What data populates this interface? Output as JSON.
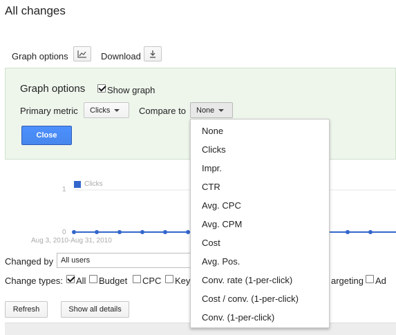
{
  "page": {
    "title": "All changes"
  },
  "toolbar": {
    "graph_options_label": "Graph options",
    "download_label": "Download"
  },
  "panel": {
    "title": "Graph options",
    "show_graph_label": "Show graph",
    "show_graph_checked": true,
    "primary_metric_label": "Primary metric",
    "primary_metric_value": "Clicks",
    "compare_to_label": "Compare to",
    "compare_to_value": "None",
    "close_label": "Close"
  },
  "chart": {
    "legend_label": "Clicks",
    "y_tick_top": "1",
    "y_tick_bottom": "0",
    "date_range": "Aug 3, 2010-Aug 31, 2010",
    "series_color": "#3366cc"
  },
  "chart_data": {
    "type": "line",
    "series": [
      {
        "name": "Clicks",
        "values": [
          0,
          0,
          0,
          0,
          0,
          0,
          0,
          0,
          0,
          0,
          0,
          0,
          0,
          0
        ]
      }
    ],
    "ylim": [
      0,
      1
    ],
    "title": "",
    "xlabel": "Aug 3, 2010-Aug 31, 2010",
    "ylabel": ""
  },
  "dropdown_menu": {
    "items": [
      "None",
      "Clicks",
      "Impr.",
      "CTR",
      "Avg. CPC",
      "Avg. CPM",
      "Cost",
      "Avg. Pos.",
      "Conv. rate (1-per-click)",
      "Cost / conv. (1-per-click)",
      "Conv. (1-per-click)"
    ]
  },
  "filters": {
    "changed_by_label": "Changed by",
    "changed_by_value": "All users",
    "change_types_label": "Change types:",
    "types": [
      {
        "label": "All",
        "checked": true
      },
      {
        "label": "Budget",
        "checked": false
      },
      {
        "label": "CPC",
        "checked": false
      },
      {
        "label": "Key",
        "checked": false
      },
      {
        "label": "argeting",
        "checked": false
      },
      {
        "label": "Ad",
        "checked": false
      }
    ]
  },
  "buttons": {
    "refresh": "Refresh",
    "show_all_details": "Show all details"
  }
}
